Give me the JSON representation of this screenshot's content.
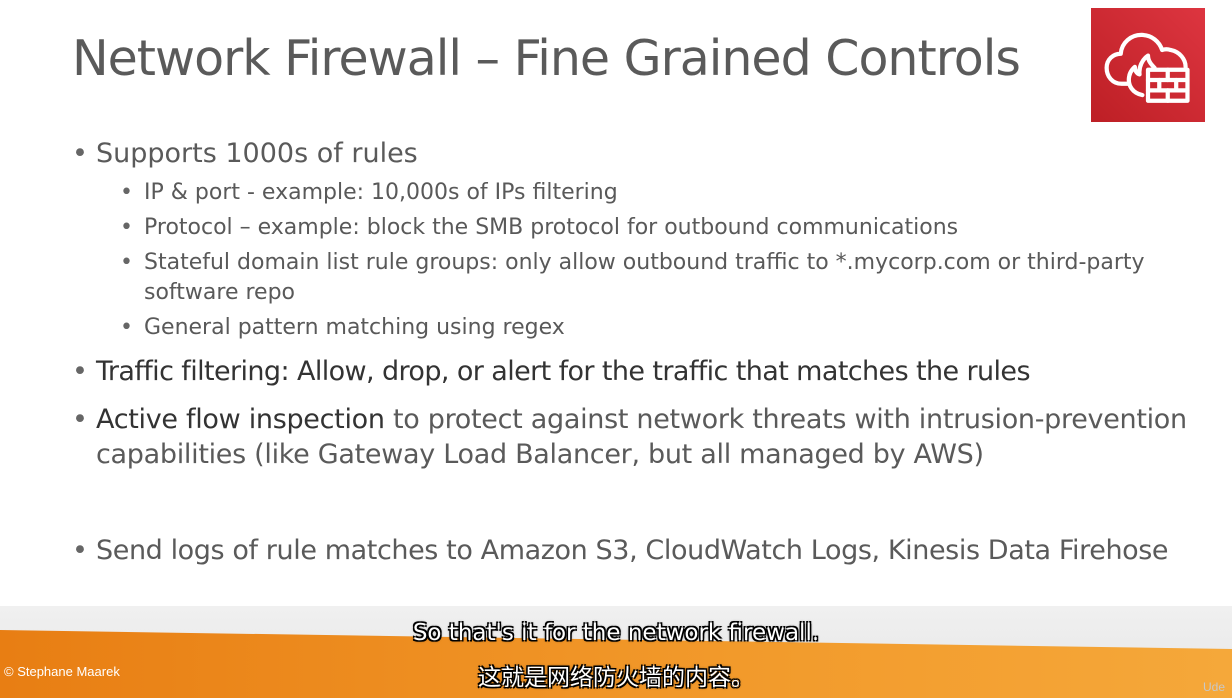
{
  "slide": {
    "title": "Network Firewall – Fine Grained Controls",
    "icon": "network-firewall-icon",
    "icon_color": "#d32f2f",
    "bullets": {
      "b1": "Supports 1000s of rules",
      "b1_sub1": "IP & port - example: 10,000s of IPs filtering",
      "b1_sub2": "Protocol – example: block the SMB protocol for outbound communications",
      "b1_sub3_line1": "Stateful domain list rule groups: only allow outbound traffic to *.mycorp.com or third-party",
      "b1_sub3_line2": "software repo",
      "b1_sub4": "General pattern matching using regex",
      "b2": "Traffic filtering: Allow, drop, or alert for the traffic that matches the rules",
      "b3_strong": "Active flow inspection",
      "b3_rest": " to protect against network threats with intrusion-prevention",
      "b3_line2": "capabilities (like Gateway Load Balancer, but all managed by AWS)",
      "b4": "Send logs of rule matches to Amazon S3, CloudWatch Logs, Kinesis Data Firehose"
    },
    "bullet_glyph": "•"
  },
  "footer": {
    "copyright": "© Stephane Maarek",
    "accent_color": "#f29a2b",
    "watermark": "Ude"
  },
  "captions": {
    "english": "So that's it for the network firewall.",
    "chinese": "这就是网络防火墙的内容。"
  }
}
